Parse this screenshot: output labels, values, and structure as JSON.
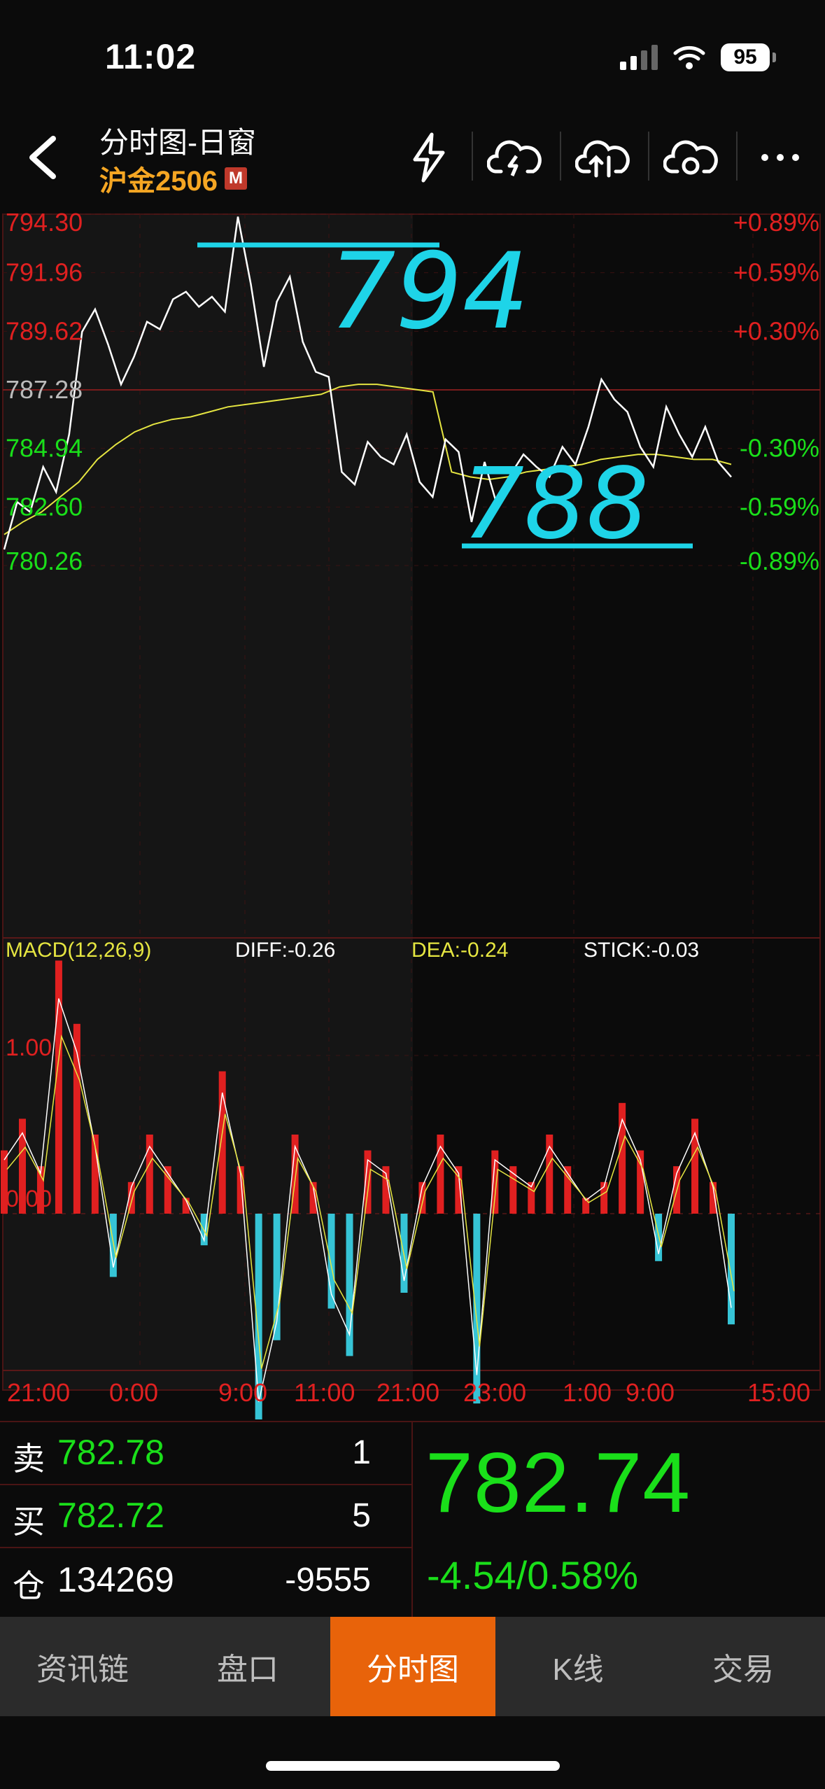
{
  "status": {
    "time": "11:02",
    "battery": "95"
  },
  "header": {
    "title": "分时图-日窗",
    "symbol": "沪金2506",
    "badge": "M"
  },
  "chart_data": [
    {
      "type": "line",
      "name": "intraday-price",
      "y_left_ticks": [
        "794.30",
        "791.96",
        "789.62",
        "787.28",
        "784.94",
        "782.60",
        "780.26"
      ],
      "y_right_ticks": [
        "+0.89%",
        "+0.59%",
        "+0.30%",
        "",
        "-0.30%",
        "-0.59%",
        "-0.89%"
      ],
      "ylim": [
        780.26,
        794.3
      ],
      "x_ticks": [
        "21:00",
        "0:00",
        "9:00",
        "11:00",
        "21:00",
        "23:00",
        "1:00",
        "9:00",
        "15:00"
      ],
      "series": [
        {
          "values": [
            780.9,
            782.8,
            782.4,
            784.2,
            783.2,
            785.5,
            789.6,
            790.5,
            789.1,
            787.5,
            788.6,
            790.0,
            789.7,
            790.9,
            791.2,
            790.6,
            791.0,
            790.4,
            794.2,
            791.5,
            788.2,
            790.8,
            791.8,
            789.2,
            788.0,
            787.8,
            784.0,
            783.5,
            785.2,
            784.6,
            784.3,
            785.5,
            783.6,
            783.0,
            785.3,
            784.8,
            782.0,
            784.4,
            782.6,
            783.9,
            784.7,
            784.2,
            783.8,
            785.0,
            784.3,
            785.8,
            787.7,
            786.9,
            786.4,
            785.0,
            784.2,
            786.6,
            785.5,
            784.6,
            785.8,
            784.4,
            783.8
          ]
        },
        {
          "values": [
            781.5,
            782.0,
            782.4,
            783.0,
            783.6,
            784.5,
            785.1,
            785.6,
            785.9,
            786.1,
            786.2,
            786.4,
            786.6,
            786.7,
            786.8,
            786.9,
            787.0,
            787.1,
            787.4,
            787.5,
            787.5,
            787.4,
            787.3,
            787.2,
            784.0,
            783.8,
            783.7,
            783.8,
            784.0,
            784.1,
            784.2,
            784.3,
            784.5,
            784.6,
            784.7,
            784.7,
            784.6,
            784.5,
            784.5,
            784.3
          ],
          "color": "#e5e541"
        }
      ],
      "annotations": [
        "794",
        "788"
      ]
    },
    {
      "type": "bar",
      "name": "MACD",
      "labels": {
        "macd": "MACD(12,26,9)",
        "diff": "DIFF:-0.26",
        "dea": "DEA:-0.24",
        "stick": "STICK:-0.03"
      },
      "y_ticks": [
        "1.00",
        "0.00"
      ],
      "values": [
        0.4,
        0.6,
        0.3,
        1.6,
        1.2,
        0.5,
        -0.4,
        0.2,
        0.5,
        0.3,
        0.1,
        -0.2,
        0.9,
        0.3,
        -1.4,
        -0.8,
        0.5,
        0.2,
        -0.6,
        -0.9,
        0.4,
        0.3,
        -0.5,
        0.2,
        0.5,
        0.3,
        -1.2,
        0.4,
        0.3,
        0.2,
        0.5,
        0.3,
        0.1,
        0.2,
        0.7,
        0.4,
        -0.3,
        0.3,
        0.6,
        0.2,
        -0.7
      ]
    }
  ],
  "orderbook": {
    "sell": {
      "label": "卖",
      "price": "782.78",
      "qty": "1"
    },
    "buy": {
      "label": "买",
      "price": "782.72",
      "qty": "5"
    },
    "oi": {
      "label": "仓",
      "value": "134269",
      "change": "-9555"
    }
  },
  "quote": {
    "price": "782.74",
    "change": "-4.54/0.58%"
  },
  "tabs": [
    {
      "label": "资讯链",
      "active": false
    },
    {
      "label": "盘口",
      "active": false
    },
    {
      "label": "分时图",
      "active": true
    },
    {
      "label": "K线",
      "active": false
    },
    {
      "label": "交易",
      "active": false
    }
  ],
  "colors": {
    "up": "#e02020",
    "down": "#1adf1a",
    "accent": "#e8630a",
    "avg": "#e5e541",
    "annotation": "#1ed4e8",
    "histo_neg": "#36c4d6"
  }
}
